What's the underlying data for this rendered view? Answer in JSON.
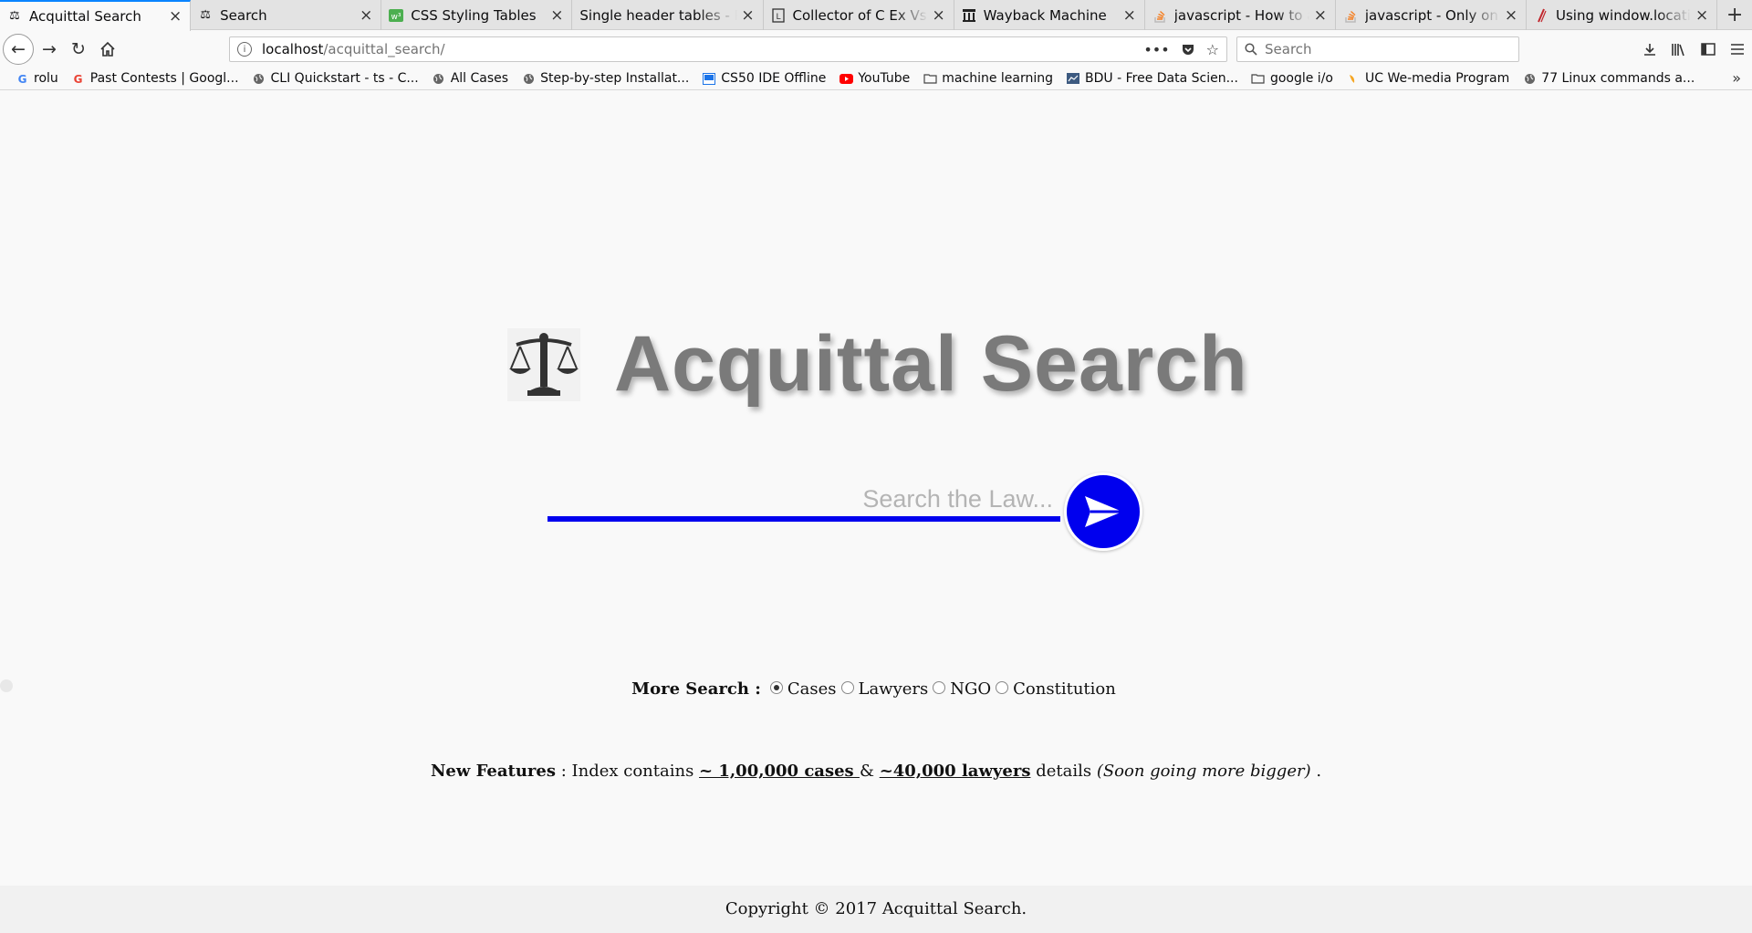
{
  "tabs": [
    {
      "title": "Acquittal Search",
      "icon": "scales-icon",
      "active": true
    },
    {
      "title": "Search",
      "icon": "scales-icon",
      "active": false
    },
    {
      "title": "CSS Styling Tables",
      "icon": "w3schools-icon",
      "active": false
    },
    {
      "title": "Single header tables - Fo",
      "icon": "",
      "active": false
    },
    {
      "title": "Collector of C Ex Vs Su",
      "icon": "document-icon",
      "active": false
    },
    {
      "title": "Wayback Machine",
      "icon": "archive-icon",
      "active": false
    },
    {
      "title": "javascript - How to ad",
      "icon": "stackoverflow-icon",
      "active": false
    },
    {
      "title": "javascript - Only on Fi",
      "icon": "stackoverflow-icon",
      "active": false
    },
    {
      "title": "Using window.locatio",
      "icon": "mdn-icon",
      "active": false
    }
  ],
  "nav": {
    "url_host": "localhost",
    "url_path": "/acquittal_search/",
    "search_placeholder": "Search"
  },
  "bookmarks": [
    {
      "label": "rolu",
      "icon": "google-icon"
    },
    {
      "label": "Past Contests | Googl...",
      "icon": "google-icon"
    },
    {
      "label": "CLI Quickstart - ts - C...",
      "icon": "globe-icon"
    },
    {
      "label": "All Cases",
      "icon": "globe-icon"
    },
    {
      "label": "Step-by-step Installat...",
      "icon": "globe-icon"
    },
    {
      "label": "CS50 IDE Offline",
      "icon": "cs50-icon"
    },
    {
      "label": "YouTube",
      "icon": "youtube-icon"
    },
    {
      "label": "machine learning",
      "icon": "folder-icon"
    },
    {
      "label": "BDU - Free Data Scien...",
      "icon": "bdu-icon"
    },
    {
      "label": "google i/o",
      "icon": "folder-icon"
    },
    {
      "label": "UC We-media Program",
      "icon": "uc-icon"
    },
    {
      "label": "77 Linux commands a...",
      "icon": "globe-icon"
    }
  ],
  "page": {
    "brand_title": "Acquittal Search",
    "search_placeholder": "Search the Law...",
    "more_search_label": "More Search :",
    "radio_options": [
      {
        "label": "Cases",
        "checked": true
      },
      {
        "label": "Lawyers",
        "checked": false
      },
      {
        "label": "NGO",
        "checked": false
      },
      {
        "label": "Constitution",
        "checked": false
      }
    ],
    "features": {
      "label": "New Features",
      "sep": " : Index contains ",
      "cases_link": "~ 1,00,000 cases ",
      "amp": " & ",
      "lawyers_link": "~40,000 lawyers",
      "details": " details ",
      "note": "(Soon going more bigger)",
      "end": " ."
    },
    "footer": "Copyright © 2017 Acquittal Search."
  },
  "colors": {
    "accent": "#0000ee",
    "title_gray": "#7a7a7a",
    "tab_highlight": "#0a84ff"
  }
}
